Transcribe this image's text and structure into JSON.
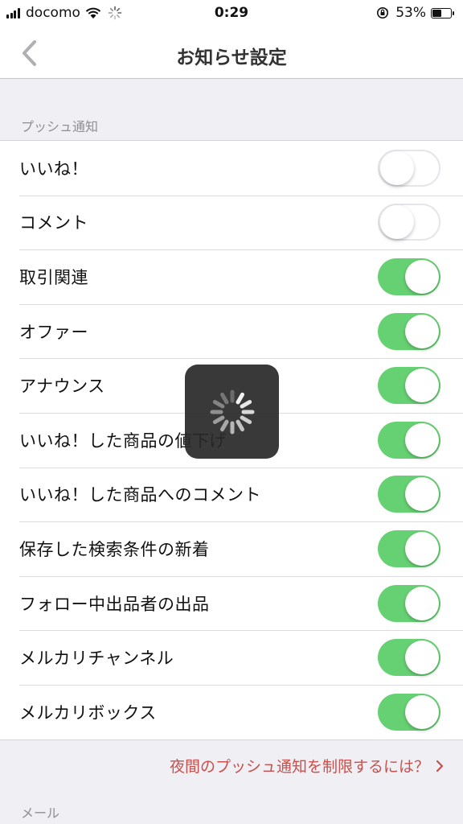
{
  "status_bar": {
    "carrier": "docomo",
    "time": "0:29",
    "battery_percent": "53%",
    "battery_level": 0.53
  },
  "nav": {
    "title": "お知らせ設定",
    "back_icon": "chevron-left-icon"
  },
  "sections": {
    "push_header": "プッシュ通知",
    "mail_header": "メール"
  },
  "push_items": [
    {
      "label": "いいね！",
      "on": false
    },
    {
      "label": "コメント",
      "on": false
    },
    {
      "label": "取引関連",
      "on": true
    },
    {
      "label": "オファー",
      "on": true
    },
    {
      "label": "アナウンス",
      "on": true
    },
    {
      "label": "いいね！した商品の値下げ",
      "on": true
    },
    {
      "label": "いいね！した商品へのコメント",
      "on": true
    },
    {
      "label": "保存した検索条件の新着",
      "on": true
    },
    {
      "label": "フォロー中出品者の出品",
      "on": true
    },
    {
      "label": "メルカリチャンネル",
      "on": true
    },
    {
      "label": "メルカリボックス",
      "on": true
    }
  ],
  "footer": {
    "night_limit_link": "夜間のプッシュ通知を制限するには？"
  },
  "colors": {
    "toggle_on": "#66d172",
    "link": "#c9504c",
    "section_text": "#8e8e93"
  }
}
